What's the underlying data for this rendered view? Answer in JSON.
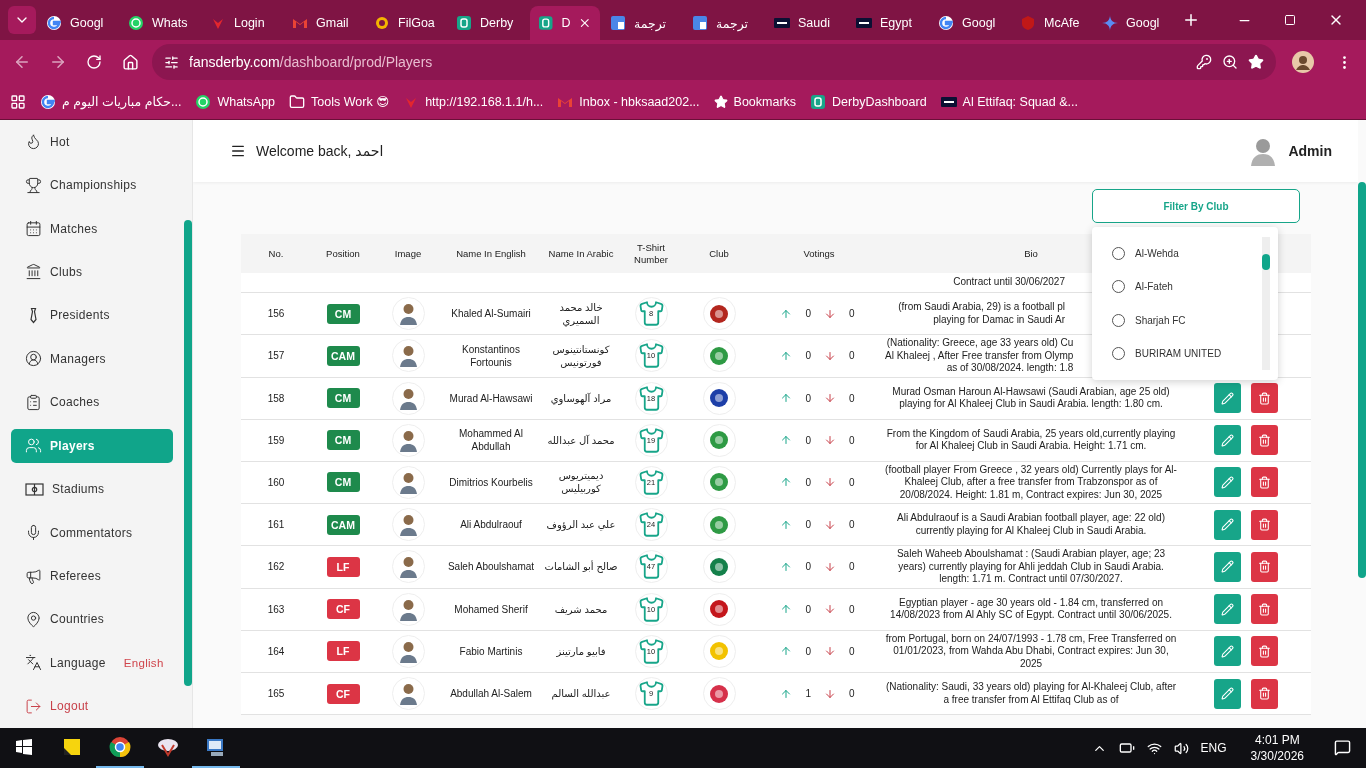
{
  "browser": {
    "tabs": [
      {
        "title": "Googl",
        "kind": "google",
        "selected": false
      },
      {
        "title": "Whats",
        "kind": "whatsapp",
        "selected": false
      },
      {
        "title": "Login",
        "kind": "huawei",
        "selected": false
      },
      {
        "title": "Gmail",
        "kind": "gmail",
        "selected": false
      },
      {
        "title": "FilGoa",
        "kind": "filgoal",
        "selected": false
      },
      {
        "title": "Derby",
        "kind": "derby",
        "selected": false
      },
      {
        "title": "D",
        "kind": "derby",
        "selected": true
      },
      {
        "title": "ترجمة",
        "kind": "translate",
        "selected": false
      },
      {
        "title": "ترجمة",
        "kind": "translate",
        "selected": false
      },
      {
        "title": "Saudi",
        "kind": "tm",
        "selected": false
      },
      {
        "title": "Egypt",
        "kind": "tm",
        "selected": false
      },
      {
        "title": "Googl",
        "kind": "google",
        "selected": false
      },
      {
        "title": "McAfe",
        "kind": "mcafee",
        "selected": false
      },
      {
        "title": "Googl",
        "kind": "gemini",
        "selected": false
      }
    ],
    "address": {
      "domain": "fansderby.com",
      "path": "/dashboard/prod/Players"
    },
    "bookmarks": [
      {
        "label": "حكام مباريات اليوم م...",
        "kind": "google"
      },
      {
        "label": "WhatsApp",
        "kind": "whatsapp"
      },
      {
        "label": "Tools Work 😎",
        "kind": "folder"
      },
      {
        "label": "http://192.168.1.1/h...",
        "kind": "huawei"
      },
      {
        "label": "Inbox - hbksaad202...",
        "kind": "gmail"
      },
      {
        "label": "Bookmarks",
        "kind": "star"
      },
      {
        "label": "DerbyDashboard",
        "kind": "derby"
      },
      {
        "label": "Al Ettifaq: Squad &...",
        "kind": "tm"
      }
    ]
  },
  "sidebar": {
    "items": [
      {
        "label": "Hot",
        "kind": "link",
        "selected": false
      },
      {
        "label": "Championships",
        "kind": "link",
        "selected": false
      },
      {
        "label": "Matches",
        "kind": "link",
        "selected": false
      },
      {
        "label": "Clubs",
        "kind": "link",
        "selected": false
      },
      {
        "label": "Presidents",
        "kind": "link",
        "selected": false
      },
      {
        "label": "Managers",
        "kind": "link",
        "selected": false
      },
      {
        "label": "Coaches",
        "kind": "link",
        "selected": false
      },
      {
        "label": "Players",
        "kind": "link",
        "selected": true
      },
      {
        "label": "Stadiums",
        "kind": "link",
        "selected": false
      },
      {
        "label": "Commentators",
        "kind": "link",
        "selected": false
      },
      {
        "label": "Referees",
        "kind": "link",
        "selected": false
      },
      {
        "label": "Countries",
        "kind": "link",
        "selected": false
      },
      {
        "label": "Language",
        "kind": "language",
        "value": "English",
        "selected": false
      },
      {
        "label": "Logout",
        "kind": "logout",
        "selected": false
      }
    ]
  },
  "header": {
    "welcome": "Welcome back, احمد",
    "user": "Admin"
  },
  "filter": {
    "label": "Filter By Club",
    "expanded": true,
    "options": [
      {
        "label": "Al-Wehda",
        "selected": false
      },
      {
        "label": "Al-Fateh",
        "selected": false
      },
      {
        "label": "Sharjah FC",
        "selected": false
      },
      {
        "label": "BURIRAM UNITED",
        "selected": false
      }
    ]
  },
  "table": {
    "columns": [
      "No.",
      "Position",
      "Image",
      "Name In English",
      "Name In Arabic",
      "T-Shirt Number",
      "Club",
      "Votings",
      "Bio"
    ],
    "rows": [
      {
        "kind": "partial",
        "bio": "Contract until 30/06/2027",
        "covered": true
      },
      {
        "kind": "full",
        "no": "156",
        "position": {
          "label": "CM",
          "color": "#1e8a4c"
        },
        "name_en": "Khaled Al-Sumairi",
        "name_ar": "خالد محمد السميري",
        "shirt": "8",
        "club": {
          "color": "#b3261e"
        },
        "up": "0",
        "down": "0",
        "bio": "(from Saudi Arabia, 29) is a football pl\nplaying for Damac in Saudi Ar",
        "covered": true
      },
      {
        "kind": "full",
        "no": "157",
        "position": {
          "label": "CAM",
          "color": "#1e8a4c"
        },
        "name_en": "Konstantinos Fortounis",
        "name_ar": "كونستانتينوس فورتونيس",
        "shirt": "10",
        "club": {
          "color": "#2e9a44"
        },
        "up": "0",
        "down": "0",
        "bio": "(Nationality: Greece, age 33 years old) Cu\nAl Khaleej , After Free transfer from Olymp\nas of 30/08/2024. length: 1.8",
        "covered": true
      },
      {
        "kind": "full",
        "no": "158",
        "position": {
          "label": "CM",
          "color": "#1e8a4c"
        },
        "name_en": "Murad Al-Hawsawi",
        "name_ar": "مراد آلهوساوي",
        "shirt": "18",
        "club": {
          "color": "#1d3fa8"
        },
        "up": "0",
        "down": "0",
        "bio": "Murad Osman Haroun Al-Hawsawi (Saudi Arabian, age 25 old) playing for Al Khaleej Club in Saudi Arabia. length: 1.80 cm.",
        "covered": false
      },
      {
        "kind": "full",
        "no": "159",
        "position": {
          "label": "CM",
          "color": "#1e8a4c"
        },
        "name_en": "Mohammed Al Abdullah",
        "name_ar": "محمد آل عبدالله",
        "shirt": "19",
        "club": {
          "color": "#2e9a44"
        },
        "up": "0",
        "down": "0",
        "bio": "From the Kingdom of Saudi Arabia, 25 years old,currently playing for Al Khaleej Club in Saudi Arabia. Height: 1.71 cm.",
        "covered": false
      },
      {
        "kind": "full",
        "no": "160",
        "position": {
          "label": "CM",
          "color": "#1e8a4c"
        },
        "name_en": "Dimitrios Kourbelis",
        "name_ar": "ديميتريوس كوربيليس",
        "shirt": "21",
        "club": {
          "color": "#2e9a44"
        },
        "up": "0",
        "down": "0",
        "bio": "(football player From Greece , 32 years old) Currently plays for Al-Khaleej Club, after a free transfer from Trabzonspor as of 20/08/2024. Height: 1.81 m, Contract expires: Jun 30, 2025",
        "covered": false
      },
      {
        "kind": "full",
        "no": "161",
        "position": {
          "label": "CAM",
          "color": "#1e8a4c"
        },
        "name_en": "Ali Abdulraouf",
        "name_ar": "علي عبد الرؤوف",
        "shirt": "24",
        "club": {
          "color": "#2e9a44"
        },
        "up": "0",
        "down": "0",
        "bio": "Ali Abdulraouf is a Saudi Arabian football player, age: 22 old) currently playing for Al Khaleej Club in Saudi Arabia.",
        "covered": false
      },
      {
        "kind": "full",
        "no": "162",
        "position": {
          "label": "LF",
          "color": "#dc3545"
        },
        "name_en": "Saleh Aboulshamat",
        "name_ar": "صالح أبو الشامات",
        "shirt": "47",
        "club": {
          "color": "#14804a"
        },
        "up": "0",
        "down": "0",
        "bio": "Saleh Waheeb Aboulshamat : (Saudi Arabian player, age; 23 years) currently playing for Ahli jeddah Club in Saudi Arabia. length: 1.71 m. Contract until 07/30/2027.",
        "covered": false
      },
      {
        "kind": "full",
        "no": "163",
        "position": {
          "label": "CF",
          "color": "#dc3545"
        },
        "name_en": "Mohamed Sherif",
        "name_ar": "محمد شريف",
        "shirt": "10",
        "club": {
          "color": "#c4161c"
        },
        "up": "0",
        "down": "0",
        "bio": "Egyptian player - age 30 years old - 1.84 cm, transferred on 14/08/2023 from Al Ahly SC of Egypt. Contract until 30/06/2025.",
        "covered": false
      },
      {
        "kind": "full",
        "no": "164",
        "position": {
          "label": "LF",
          "color": "#dc3545"
        },
        "name_en": "Fabio Martinis",
        "name_ar": "فابيو مارتينز",
        "shirt": "10",
        "club": {
          "color": "#f2c200"
        },
        "up": "0",
        "down": "0",
        "bio": "from Portugal, born on 24/07/1993 - 1.78 cm, Free Transferred on 01/01/2023, from Wahda Abu Dhabi, Contract expires: Jun 30, 2025",
        "covered": false
      },
      {
        "kind": "full",
        "no": "165",
        "position": {
          "label": "CF",
          "color": "#dc3545"
        },
        "name_en": "Abdullah Al-Salem",
        "name_ar": "عبدالله السالم",
        "shirt": "9",
        "club": {
          "color": "#d6304a"
        },
        "up": "1",
        "down": "0",
        "bio": "(Nationality: Saudi, 33 years old) playing for Al-Khaleej Club, after a free transfer from Al Ettifaq Club as of",
        "covered": false
      }
    ]
  },
  "taskbar": {
    "language": "ENG",
    "time": "4:01 PM",
    "date": "3/30/2026"
  }
}
